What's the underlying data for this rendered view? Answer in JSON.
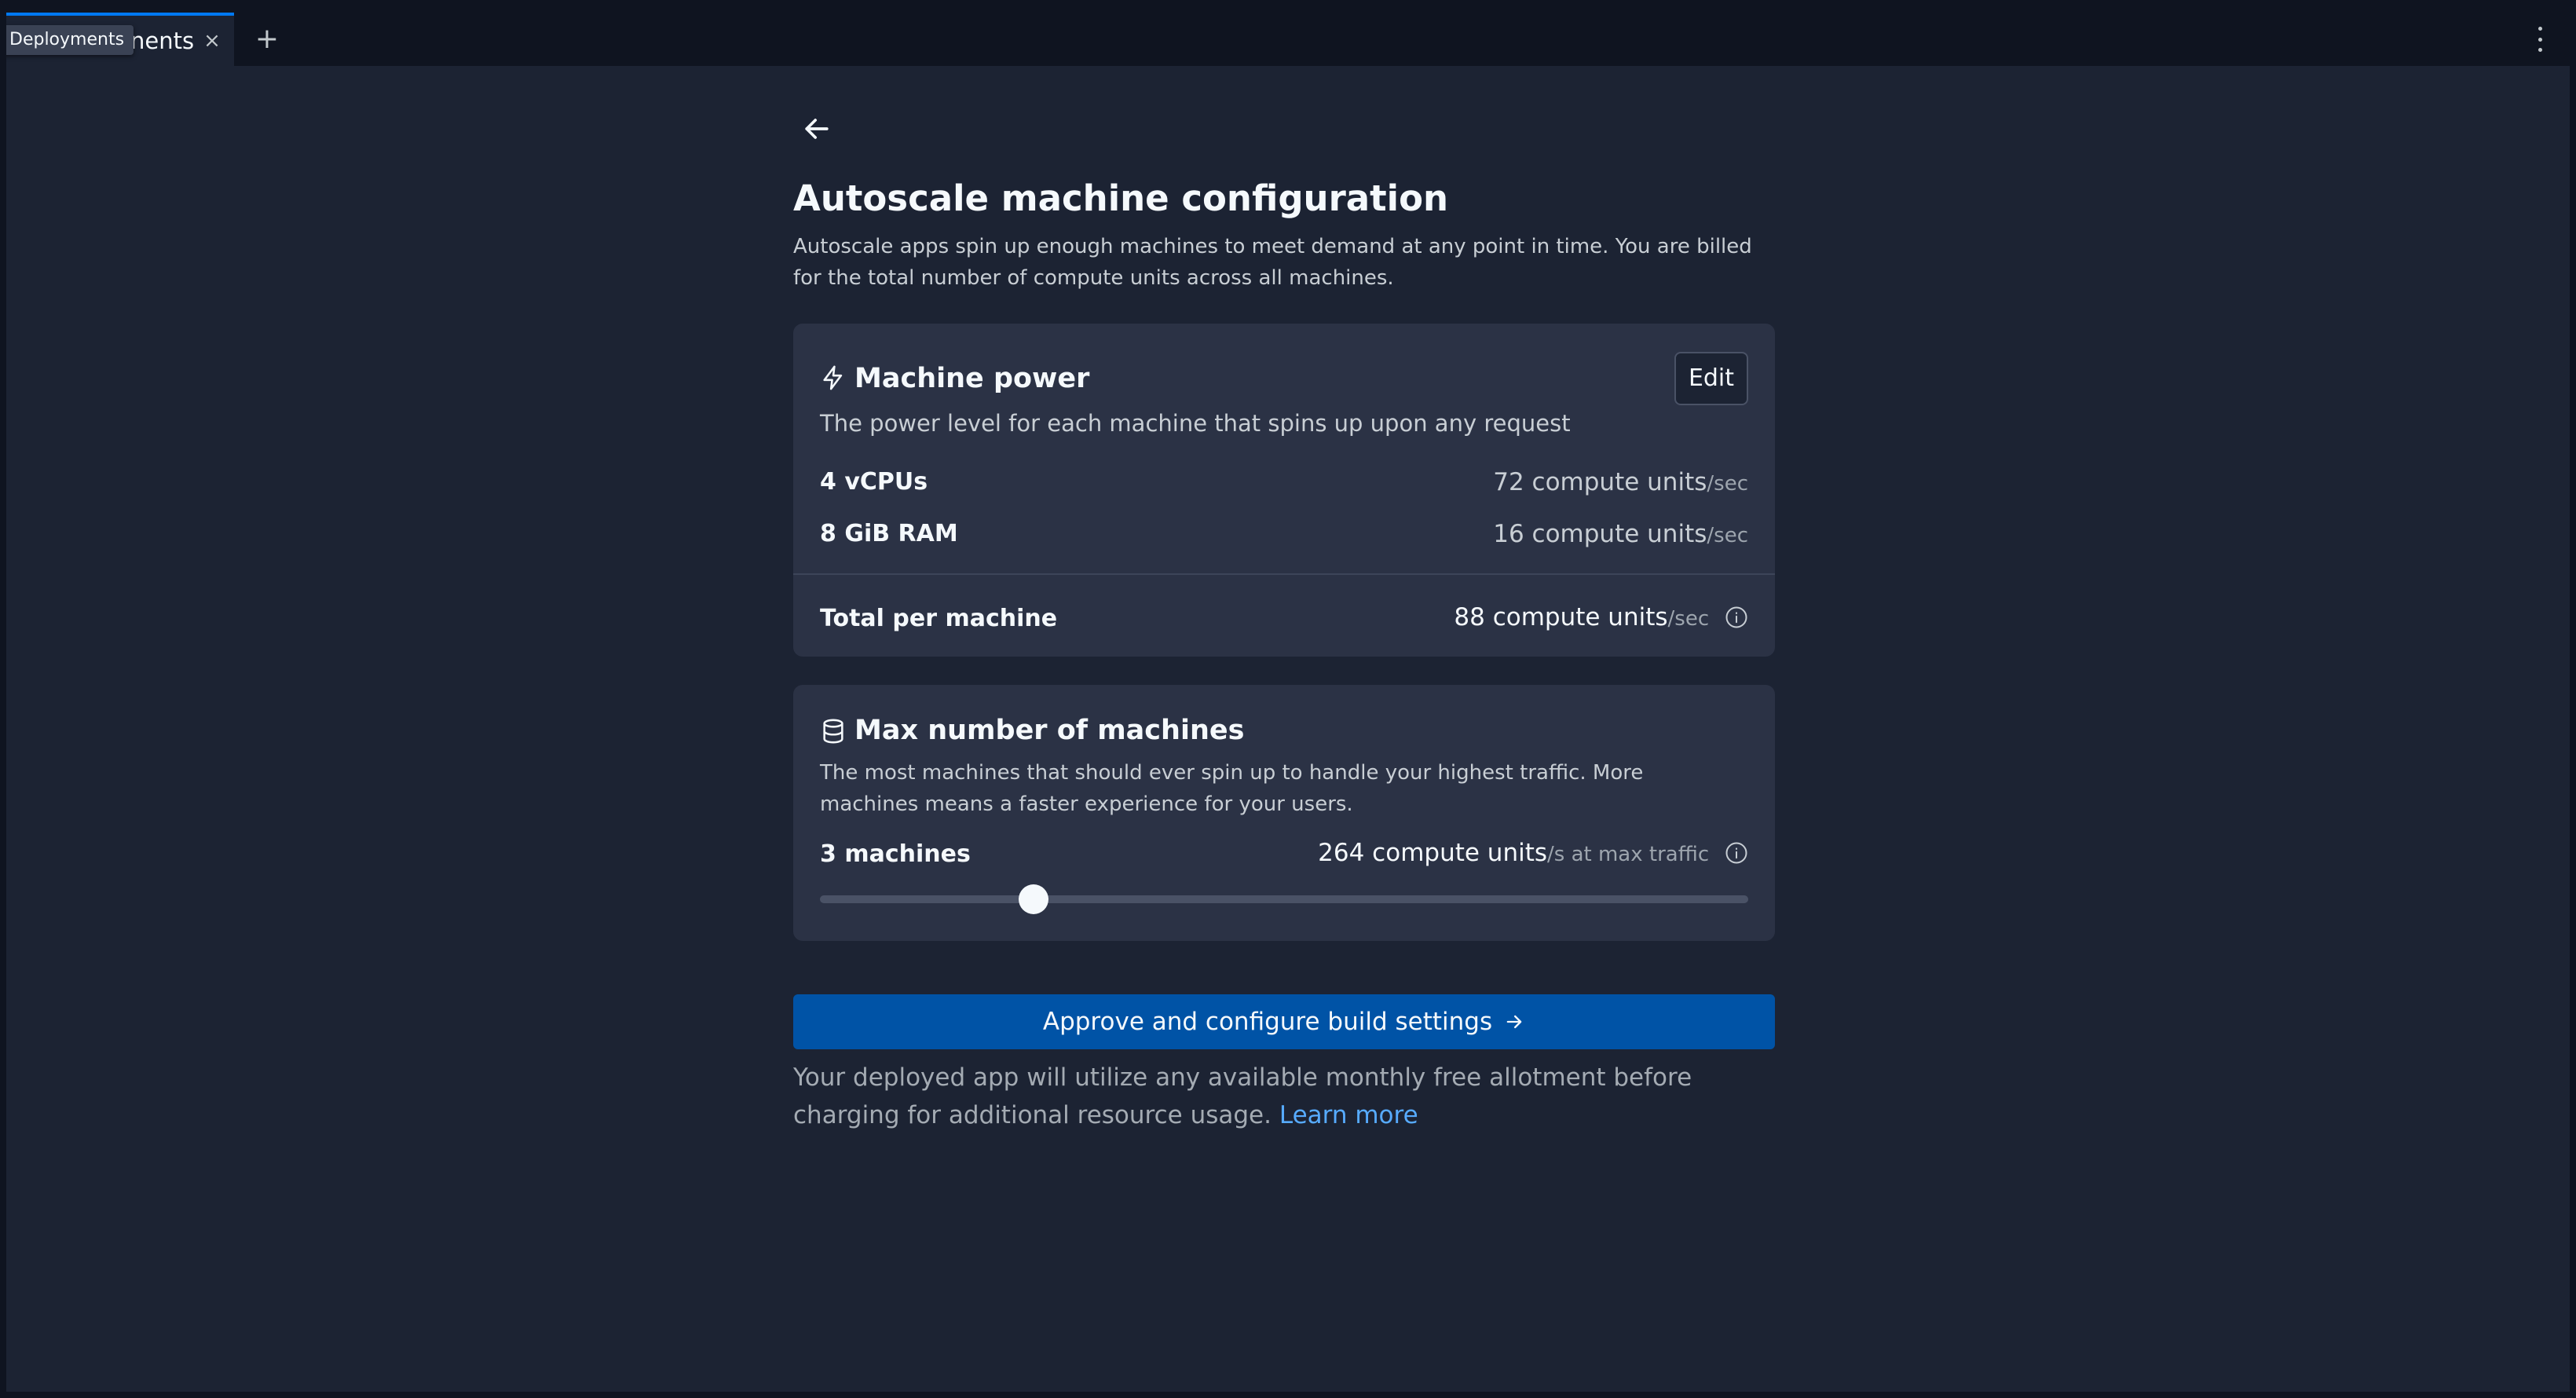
{
  "tabbar": {
    "tab_label": "nents",
    "tooltip": "Deployments",
    "close_glyph": "×",
    "add_glyph": "+"
  },
  "page": {
    "title": "Autoscale machine configuration",
    "description": "Autoscale apps spin up enough machines to meet demand at any point in time. You are billed for the total number of compute units across all machines."
  },
  "machine_power": {
    "icon": "lightning-icon",
    "title": "Machine power",
    "subtitle": "The power level for each machine that spins up upon any request",
    "edit_label": "Edit",
    "rows": [
      {
        "label": "4 vCPUs",
        "value": "72 compute units",
        "unit": "/sec"
      },
      {
        "label": "8 GiB RAM",
        "value": "16 compute units",
        "unit": "/sec"
      }
    ],
    "total": {
      "label": "Total per machine",
      "value": "88 compute units",
      "unit": "/sec"
    }
  },
  "max_machines": {
    "icon": "database-icon",
    "title": "Max number of machines",
    "description": "The most machines that should ever spin up to handle your highest traffic. More machines means a faster experience for your users.",
    "count_label": "3 machines",
    "value": "264 compute units",
    "unit": "/s at max traffic",
    "slider_fraction": 0.23
  },
  "approve_label": "Approve and configure build settings",
  "footnote": {
    "text": "Your deployed app will utilize any available monthly free allotment before charging for additional resource usage.",
    "link": "Learn more"
  },
  "colors": {
    "accent": "#0053a6",
    "link": "#57abff",
    "background": "#1c2333",
    "card": "#2b3245"
  }
}
